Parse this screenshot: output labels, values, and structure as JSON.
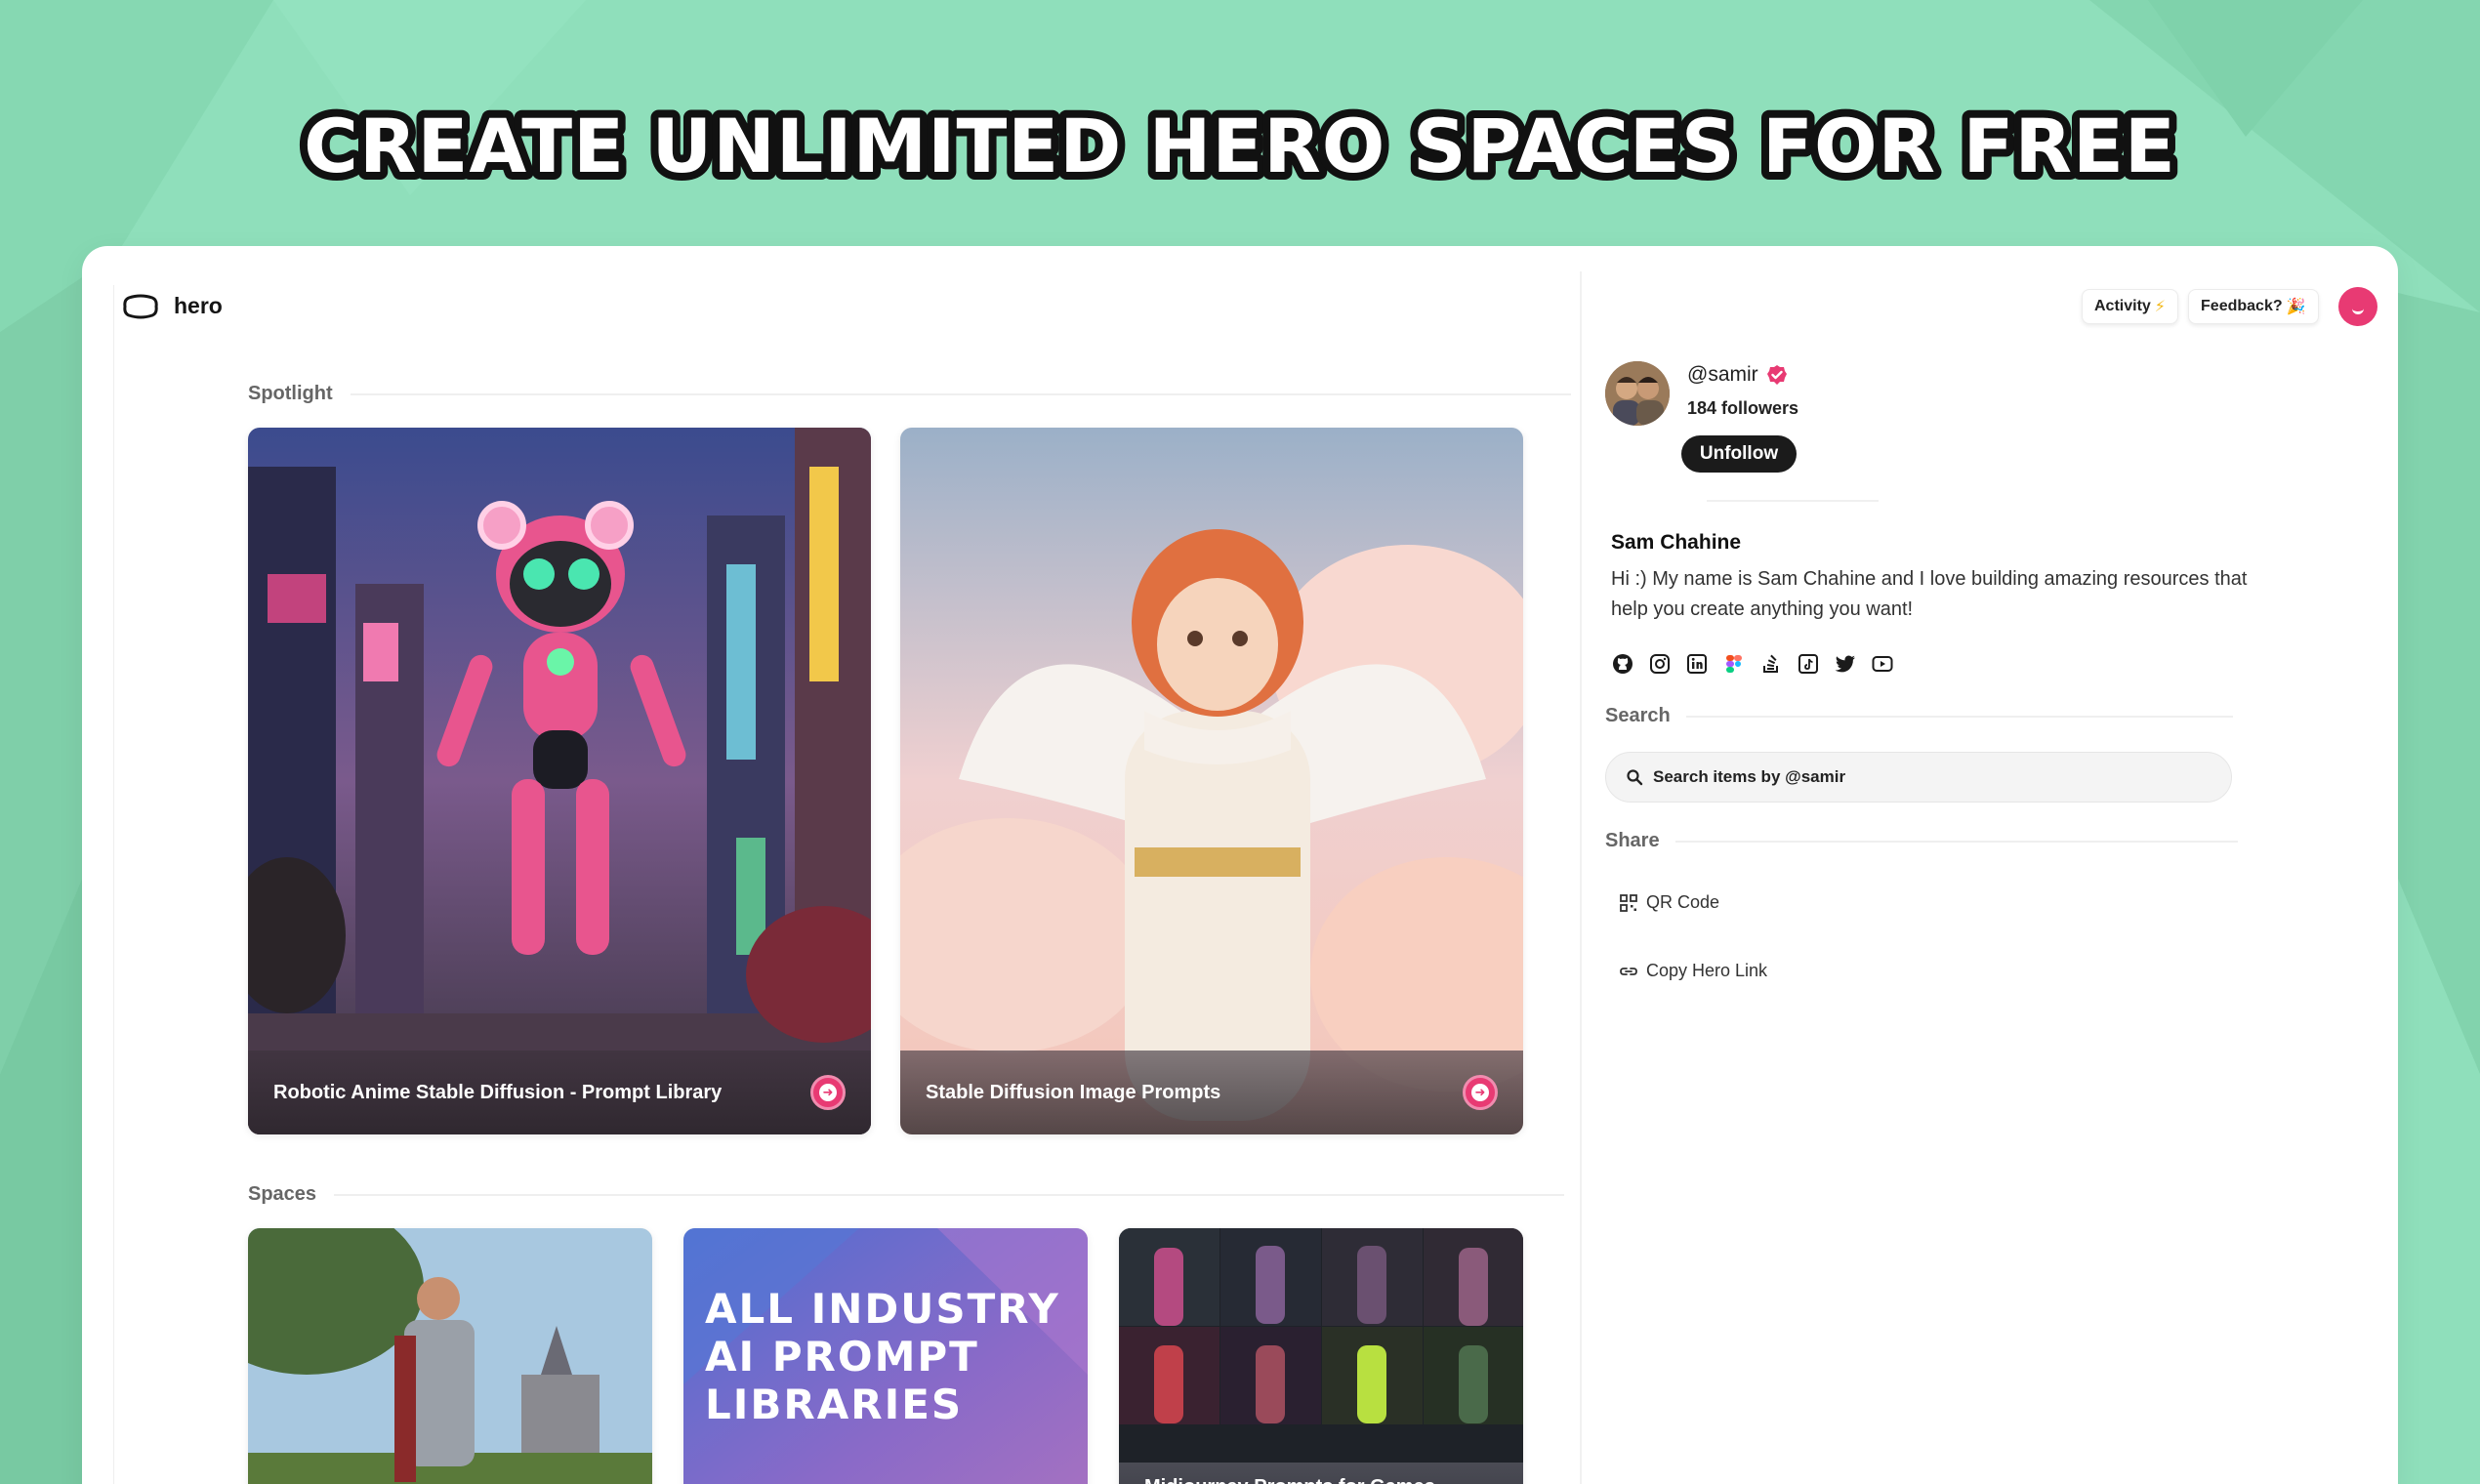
{
  "headline": "CREATE UNLIMITED HERO SPACES FOR FREE",
  "brand": {
    "name": "hero"
  },
  "header": {
    "activity_label": "Activity",
    "activity_emoji": "⚡",
    "feedback_label": "Feedback?",
    "feedback_emoji": "🎉"
  },
  "sections": {
    "spotlight": "Spotlight",
    "spaces": "Spaces"
  },
  "spotlight": [
    {
      "title": "Robotic Anime Stable Diffusion - Prompt Library"
    },
    {
      "title": "Stable Diffusion Image Prompts"
    }
  ],
  "spaces": [
    {
      "title": ""
    },
    {
      "title": "ALL INDUSTRY AI PROMPT LIBRARIES"
    },
    {
      "title": "Midjourney Prompts for Games -"
    }
  ],
  "profile": {
    "handle": "@samir",
    "followers": "184 followers",
    "unfollow_label": "Unfollow",
    "full_name": "Sam Chahine",
    "bio": "Hi :) My name is Sam Chahine and I love building amazing resources that help you create anything you want!",
    "socials": [
      "github-icon",
      "instagram-icon",
      "linkedin-icon",
      "figma-icon",
      "stackoverflow-icon",
      "tiktok-icon",
      "twitter-icon",
      "youtube-icon"
    ]
  },
  "search": {
    "label": "Search",
    "placeholder": "Search items by @samir"
  },
  "share": {
    "label": "Share",
    "qr_label": "QR Code",
    "copy_label": "Copy Hero Link"
  },
  "colors": {
    "background": "#8fdfbb",
    "accent": "#e83a73",
    "dark": "#1b1b1b"
  }
}
